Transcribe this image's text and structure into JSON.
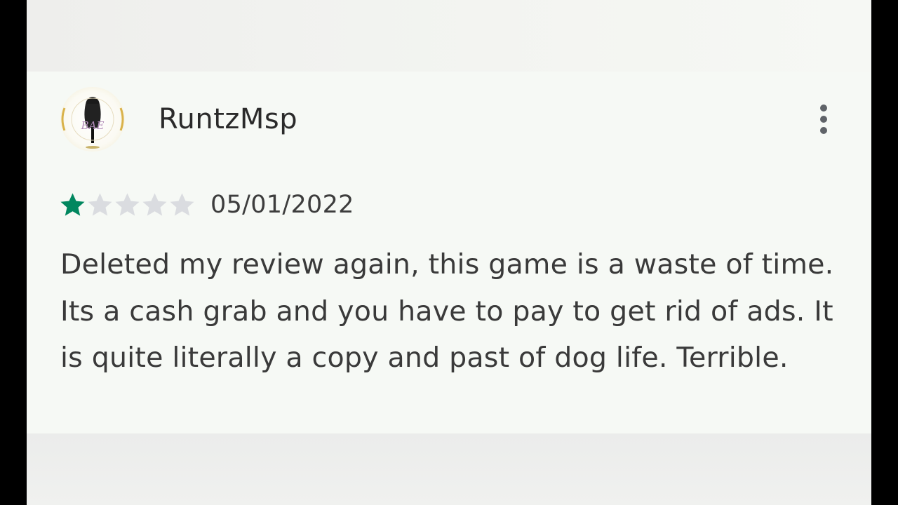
{
  "review": {
    "reviewer_name": "RuntzMsp",
    "rating": 1,
    "max_rating": 5,
    "date": "05/01/2022",
    "text": "Deleted my review again, this game is a waste of time. Its a cash grab and you have to pay to get rid of ads. It is quite literally a copy and past of dog life. Terrible.",
    "avatar_text": "BAE",
    "menu_icon": "more-vert-icon"
  },
  "colors": {
    "star_filled": "#01875f",
    "star_empty": "#dadce0",
    "text": "#3a3a3a",
    "card_bg": "#f6f9f5"
  }
}
